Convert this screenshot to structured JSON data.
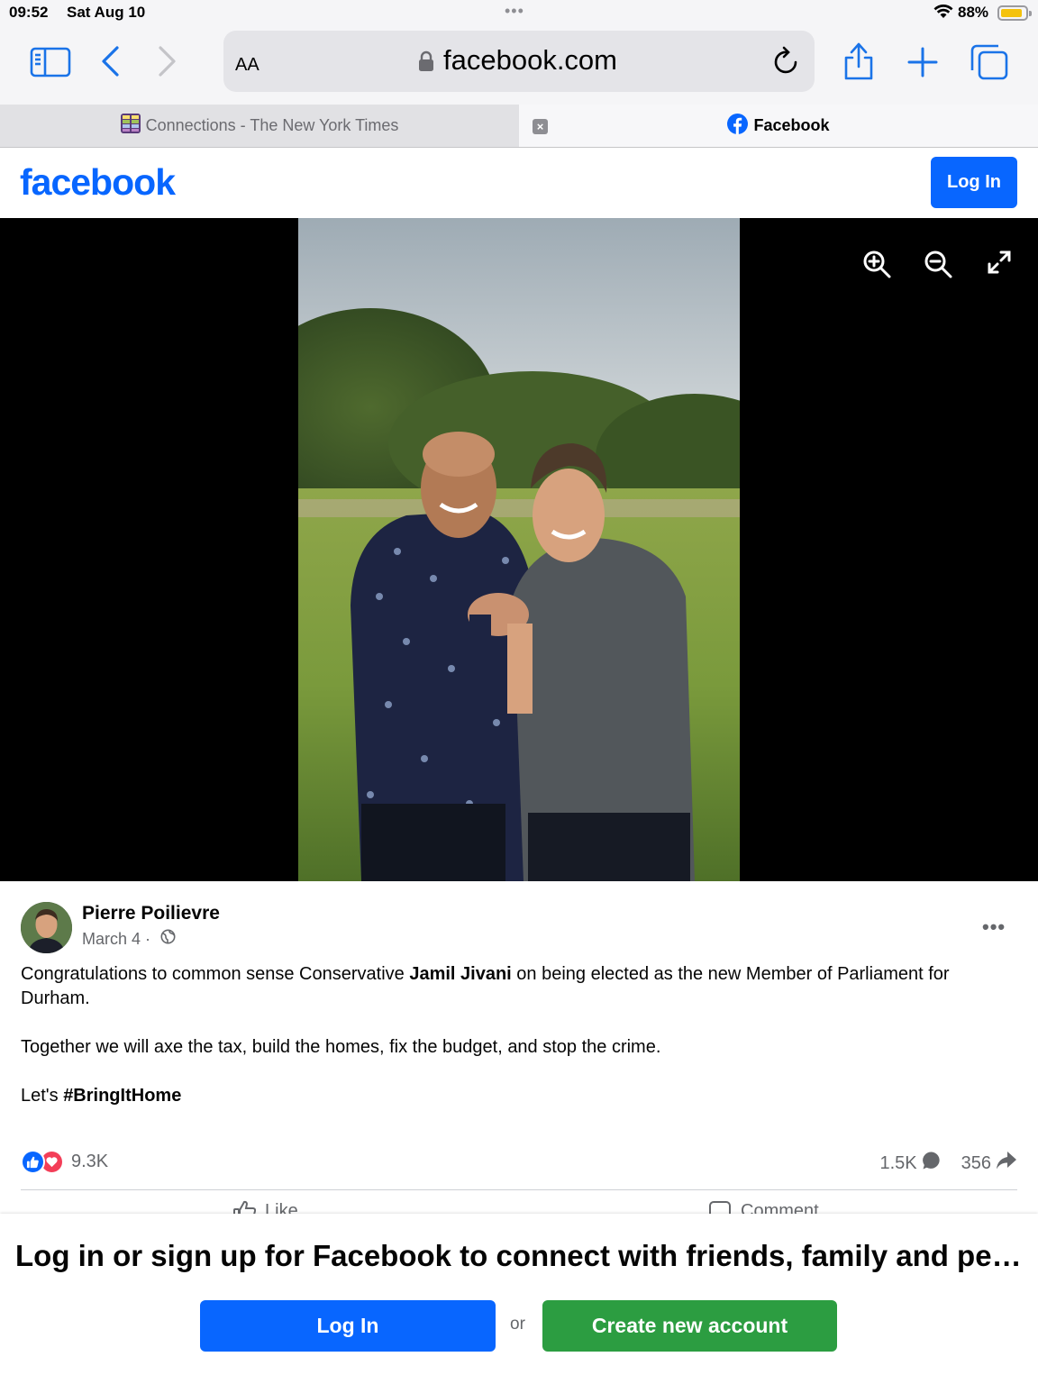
{
  "status_bar": {
    "time": "09:52",
    "date": "Sat Aug 10",
    "battery": "88%",
    "battery_level": 0.88
  },
  "browser": {
    "text_size_label": "AA",
    "url": "facebook.com",
    "tabs": [
      {
        "label": "Connections - The New York Times",
        "active": false,
        "icon": "nyt-connections-icon"
      },
      {
        "label": "Facebook",
        "active": true,
        "icon": "facebook-icon"
      }
    ],
    "tab_close_glyph": "×"
  },
  "fb_header": {
    "logo": "facebook",
    "login_label": "Log In"
  },
  "post": {
    "author": "Pierre Poilievre",
    "date": "March 4",
    "meta_separator": " · ",
    "more_glyph": "•••",
    "text": {
      "line1_before": "Congratulations to common sense Conservative ",
      "line1_bold": "Jamil Jivani",
      "line1_after": " on being elected as the new Member of Parliament for Durham.",
      "paragraph2": "Together we will axe the tax, build the homes, fix the budget, and stop the crime.",
      "paragraph3_before": "Let's ",
      "hashtag": "#BringItHome"
    },
    "reaction_count": "9.3K",
    "comment_count": "1.5K",
    "share_count": "356",
    "actions": {
      "like": "Like",
      "comment": "Comment"
    }
  },
  "prompt": {
    "title": "Log in or sign up for Facebook to connect with friends, family and people you know.",
    "login_label": "Log In",
    "or_label": "or",
    "create_label": "Create new account"
  },
  "colors": {
    "facebook_blue": "#0866ff",
    "safari_blue": "#1a73e8",
    "create_green": "#2c9d41",
    "love_red": "#f33e58",
    "battery_yellow": "#f4c20d"
  }
}
